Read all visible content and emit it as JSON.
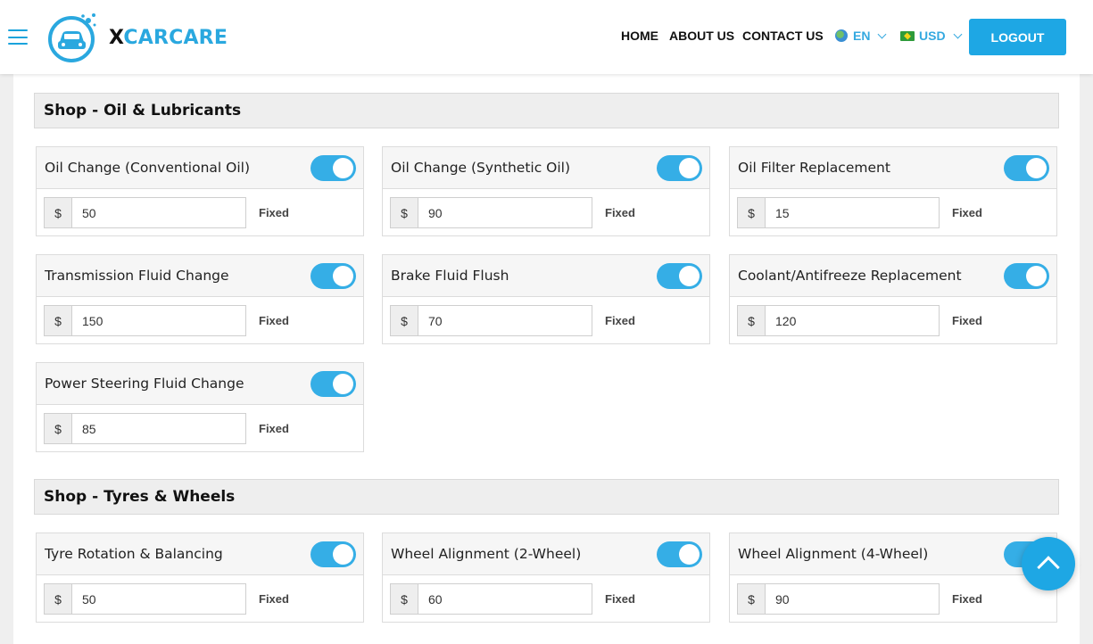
{
  "brand": {
    "logo_x": "X",
    "logo_rest": "CARCARE",
    "accent": "#1ea7e4"
  },
  "nav": {
    "home": "HOME",
    "about": "ABOUT US",
    "contact": "CONTACT US",
    "language": "EN",
    "currency": "USD",
    "logout": "LOGOUT"
  },
  "sections": [
    {
      "title": "Shop - Oil & Lubricants",
      "services": [
        {
          "name": "Oil Change (Conventional Oil)",
          "currency": "$",
          "price": "50",
          "type": "Fixed",
          "enabled": true
        },
        {
          "name": "Oil Change (Synthetic Oil)",
          "currency": "$",
          "price": "90",
          "type": "Fixed",
          "enabled": true
        },
        {
          "name": "Oil Filter Replacement",
          "currency": "$",
          "price": "15",
          "type": "Fixed",
          "enabled": true
        },
        {
          "name": "Transmission Fluid Change",
          "currency": "$",
          "price": "150",
          "type": "Fixed",
          "enabled": true
        },
        {
          "name": "Brake Fluid Flush",
          "currency": "$",
          "price": "70",
          "type": "Fixed",
          "enabled": true
        },
        {
          "name": "Coolant/Antifreeze Replacement",
          "currency": "$",
          "price": "120",
          "type": "Fixed",
          "enabled": true
        },
        {
          "name": "Power Steering Fluid Change",
          "currency": "$",
          "price": "85",
          "type": "Fixed",
          "enabled": true
        }
      ]
    },
    {
      "title": "Shop - Tyres & Wheels",
      "services": [
        {
          "name": "Tyre Rotation & Balancing",
          "currency": "$",
          "price": "50",
          "type": "Fixed",
          "enabled": true
        },
        {
          "name": "Wheel Alignment (2-Wheel)",
          "currency": "$",
          "price": "60",
          "type": "Fixed",
          "enabled": true
        },
        {
          "name": "Wheel Alignment (4-Wheel)",
          "currency": "$",
          "price": "90",
          "type": "Fixed",
          "enabled": true
        }
      ]
    }
  ]
}
